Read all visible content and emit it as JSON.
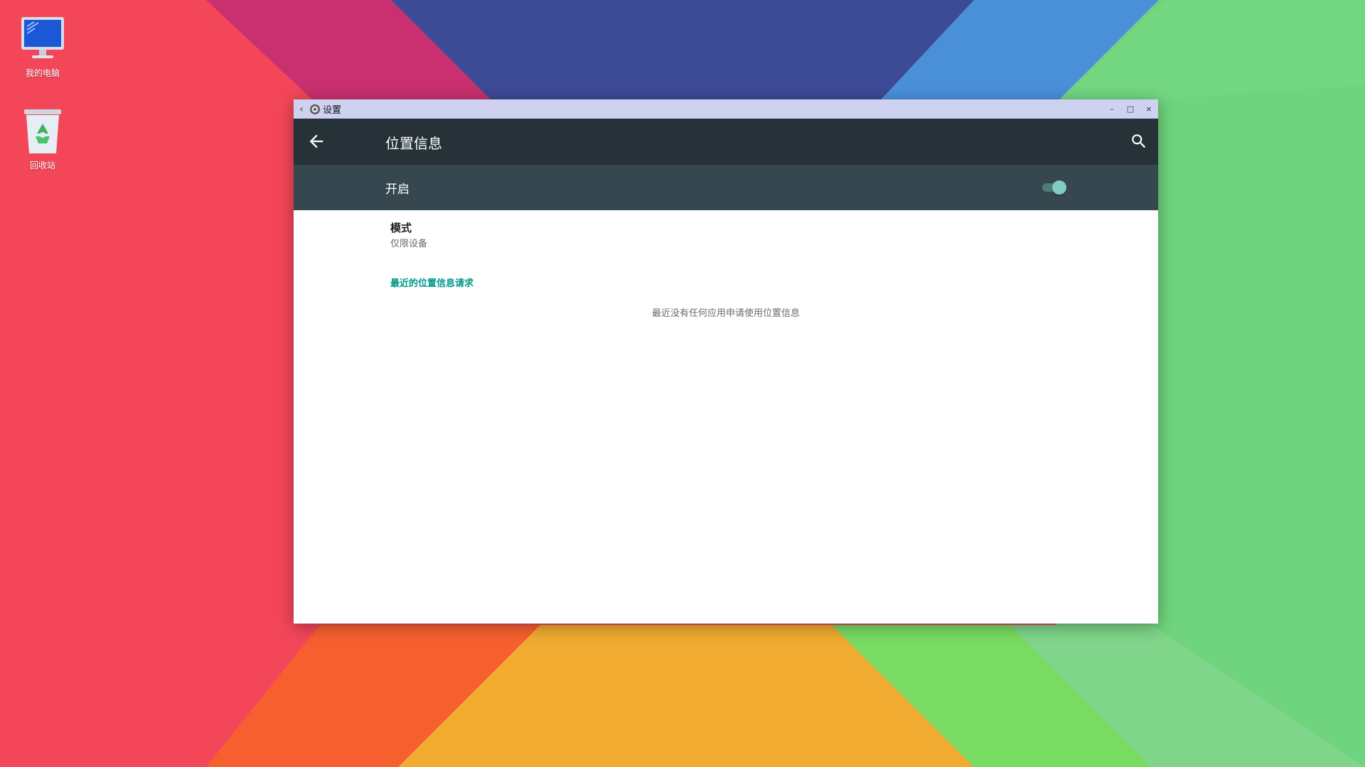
{
  "desktop": {
    "icons": [
      {
        "label": "我的电脑",
        "icon": "computer-monitor-icon"
      },
      {
        "label": "回收站",
        "icon": "recycle-bin-icon"
      }
    ],
    "colors": {
      "red": "#f44659",
      "magenta": "#c9306f",
      "indigo": "#3d4a95",
      "blue": "#4a90d9",
      "green": "#6fd47d",
      "orange": "#f7602e",
      "yellow": "#f0ab30",
      "lime": "#78dc62"
    }
  },
  "window": {
    "title": "设置",
    "app_icon": "settings-gear-icon",
    "controls": {
      "back": "‹",
      "minimize": "–",
      "maximize": "□",
      "close": "×"
    },
    "appbar": {
      "title": "位置信息",
      "back_icon": "arrow-back-icon",
      "search_icon": "search-icon",
      "color": "#263238"
    },
    "master_switch": {
      "label": "开启",
      "checked": true,
      "color": "#37474f",
      "accent": "#80cbc4"
    },
    "preferences": [
      {
        "title": "模式",
        "summary": "仅限设备"
      }
    ],
    "recent_section": {
      "header": "最近的位置信息请求",
      "empty_text": "最近没有任何应用申请使用位置信息",
      "accent": "#009688"
    }
  }
}
